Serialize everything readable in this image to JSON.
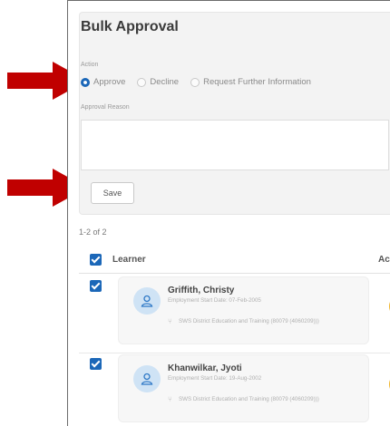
{
  "bulk_approval": {
    "title": "Bulk Approval",
    "action_label": "Action",
    "options": [
      {
        "label": "Approve",
        "selected": true
      },
      {
        "label": "Decline",
        "selected": false
      },
      {
        "label": "Request Further Information",
        "selected": false
      }
    ],
    "reason_label": "Approval Reason",
    "reason_value": "",
    "save_label": "Save"
  },
  "results": {
    "count": "1-2 of 2",
    "header_learner": "Learner",
    "header_next": "Ac",
    "rows": [
      {
        "name": "Griffith, Christy",
        "meta": "Employment Start Date: 07-Feb-2005",
        "org": "SWS District Education and Training (80079 (4060209)))"
      },
      {
        "name": "Khanwilkar, Jyoti",
        "meta": "Employment Start Date: 19-Aug-2002",
        "org": "SWS District Education and Training (80079 (4060209)))"
      }
    ]
  },
  "colors": {
    "accent": "#1b67b8",
    "annotation_arrow": "#c00000",
    "chip": "#f0b429"
  }
}
